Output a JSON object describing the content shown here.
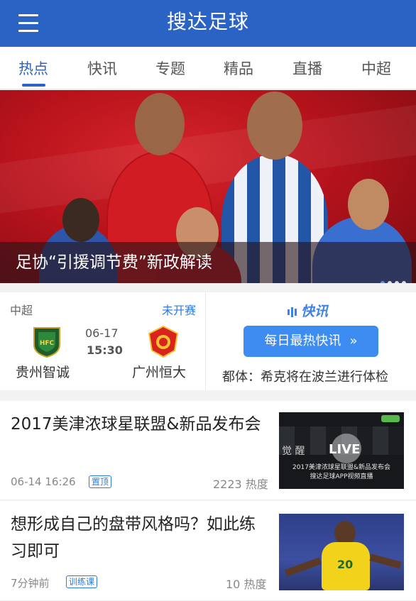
{
  "header": {
    "title": "搜达足球"
  },
  "tabs": [
    {
      "label": "热点",
      "active": true
    },
    {
      "label": "快讯"
    },
    {
      "label": "专题"
    },
    {
      "label": "精品"
    },
    {
      "label": "直播"
    },
    {
      "label": "中超"
    }
  ],
  "banner": {
    "caption": "足协“引援调节费”新政解读",
    "dots": 4,
    "active_dot": 1
  },
  "match": {
    "league": "中超",
    "status": "未开赛",
    "date": "06-17",
    "time": "15:30",
    "home": {
      "name": "贵州智诚",
      "logo_text": "HFC"
    },
    "away": {
      "name": "广州恒大"
    }
  },
  "quick_news": {
    "logo": "快讯",
    "button_label": "每日最热快讯",
    "headline": "都体：希克将在波兰进行体检"
  },
  "articles": [
    {
      "title": "2017美津浓球星联盟&新品发布会",
      "time": "06-14 16:26",
      "badge": "置顶",
      "hot": "2223 热度",
      "thumb": {
        "live": "LIVE",
        "subtitle_1": "2017美津浓球星联盟&新品发布会",
        "subtitle_2": "搜达足球APP视频直播",
        "word": "觉 醒"
      }
    },
    {
      "title": "想形成自己的盘带风格吗？如此练习即可",
      "time": "7分钟前",
      "badge": "训练课",
      "hot": "10 热度",
      "thumb": {
        "number": "20"
      }
    }
  ],
  "colors": {
    "brand_blue": "#2a63c4",
    "accent_blue": "#2a7be0",
    "banner_red": "#c8161f"
  }
}
